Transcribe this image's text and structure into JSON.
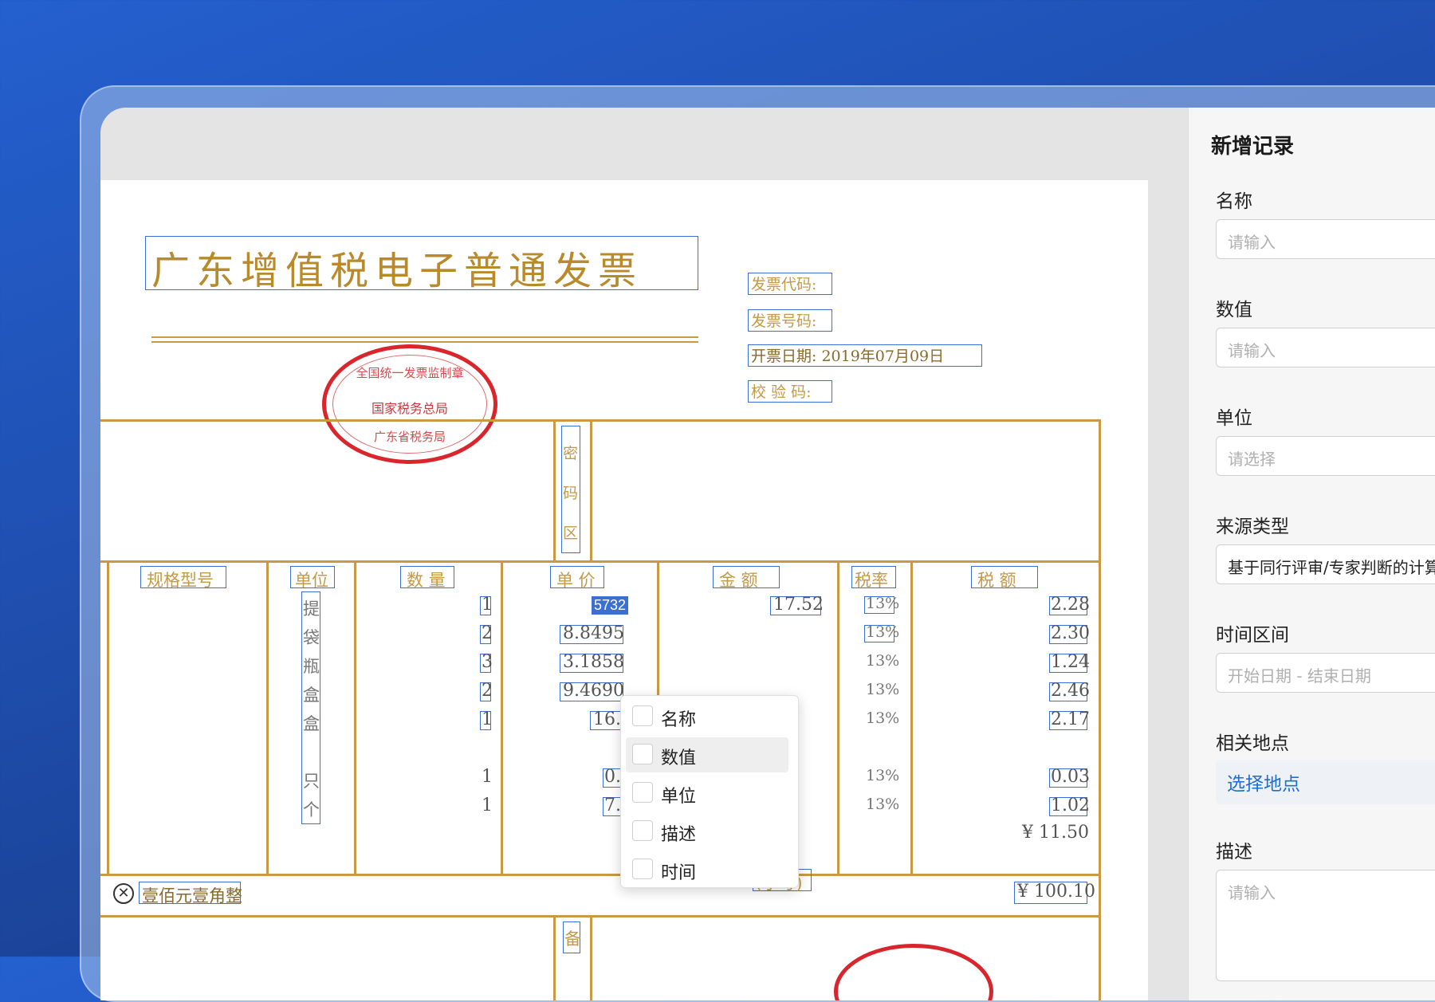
{
  "panel": {
    "title": "新增记录",
    "fields": {
      "name": {
        "label": "名称",
        "placeholder": "请输入"
      },
      "value": {
        "label": "数值",
        "placeholder": "请输入"
      },
      "unit": {
        "label": "单位",
        "placeholder": "请选择"
      },
      "source_type": {
        "label": "来源类型",
        "value": "基于同行评审/专家判断的计算"
      },
      "time_range": {
        "label": "时间区间",
        "placeholder": "开始日期 - 结束日期"
      },
      "location": {
        "label": "相关地点",
        "link": "选择地点"
      },
      "description": {
        "label": "描述",
        "placeholder": "请输入"
      }
    }
  },
  "invoice": {
    "title": "广东增值税电子普通发票",
    "stamp": {
      "top": "全国统一发票监制章",
      "middle": "国家税务总局",
      "bottom": "广东省税务局"
    },
    "meta": {
      "code_label": "发票代码:",
      "number_label": "发票号码:",
      "date_label": "开票日期: 2019年07月09日",
      "check_label": "校 验 码:"
    },
    "cipher_area": "密码区",
    "headers": {
      "spec": "规格型号",
      "unit": "单位",
      "qty": "数 量",
      "price": "单 价",
      "amount": "金 额",
      "rate": "税率",
      "tax": "税 额"
    },
    "unit_column": [
      "提",
      "袋",
      "瓶",
      "盒",
      "盒",
      "",
      "只",
      "个"
    ],
    "qty_column": [
      "1",
      "2",
      "3",
      "2",
      "1",
      "",
      "1",
      "1"
    ],
    "price_column": [
      "5732",
      "8.8495",
      "3.1858",
      "9.4690",
      "16.",
      "",
      "0.",
      "7."
    ],
    "amount_column": [
      "17.52"
    ],
    "rate_column": [
      "13%",
      "13%",
      "13%",
      "13%",
      "13%",
      "",
      "13%",
      "13%"
    ],
    "tax_column": [
      "2.28",
      "2.30",
      "1.24",
      "2.46",
      "2.17",
      "",
      "0.03",
      "1.02"
    ],
    "tax_total": "¥ 11.50",
    "total_in_words": "壹佰元壹角整",
    "small_label": "(小写)",
    "total_small": "¥ 100.10",
    "remarks": "备"
  },
  "context_menu": {
    "items": [
      "名称",
      "数值",
      "单位",
      "描述",
      "时间"
    ],
    "hovered": "数值"
  },
  "colors": {
    "accent": "#3b6fd8",
    "ink": "#c79a43",
    "stamp": "#d9262c",
    "link": "#1d6fd1"
  }
}
